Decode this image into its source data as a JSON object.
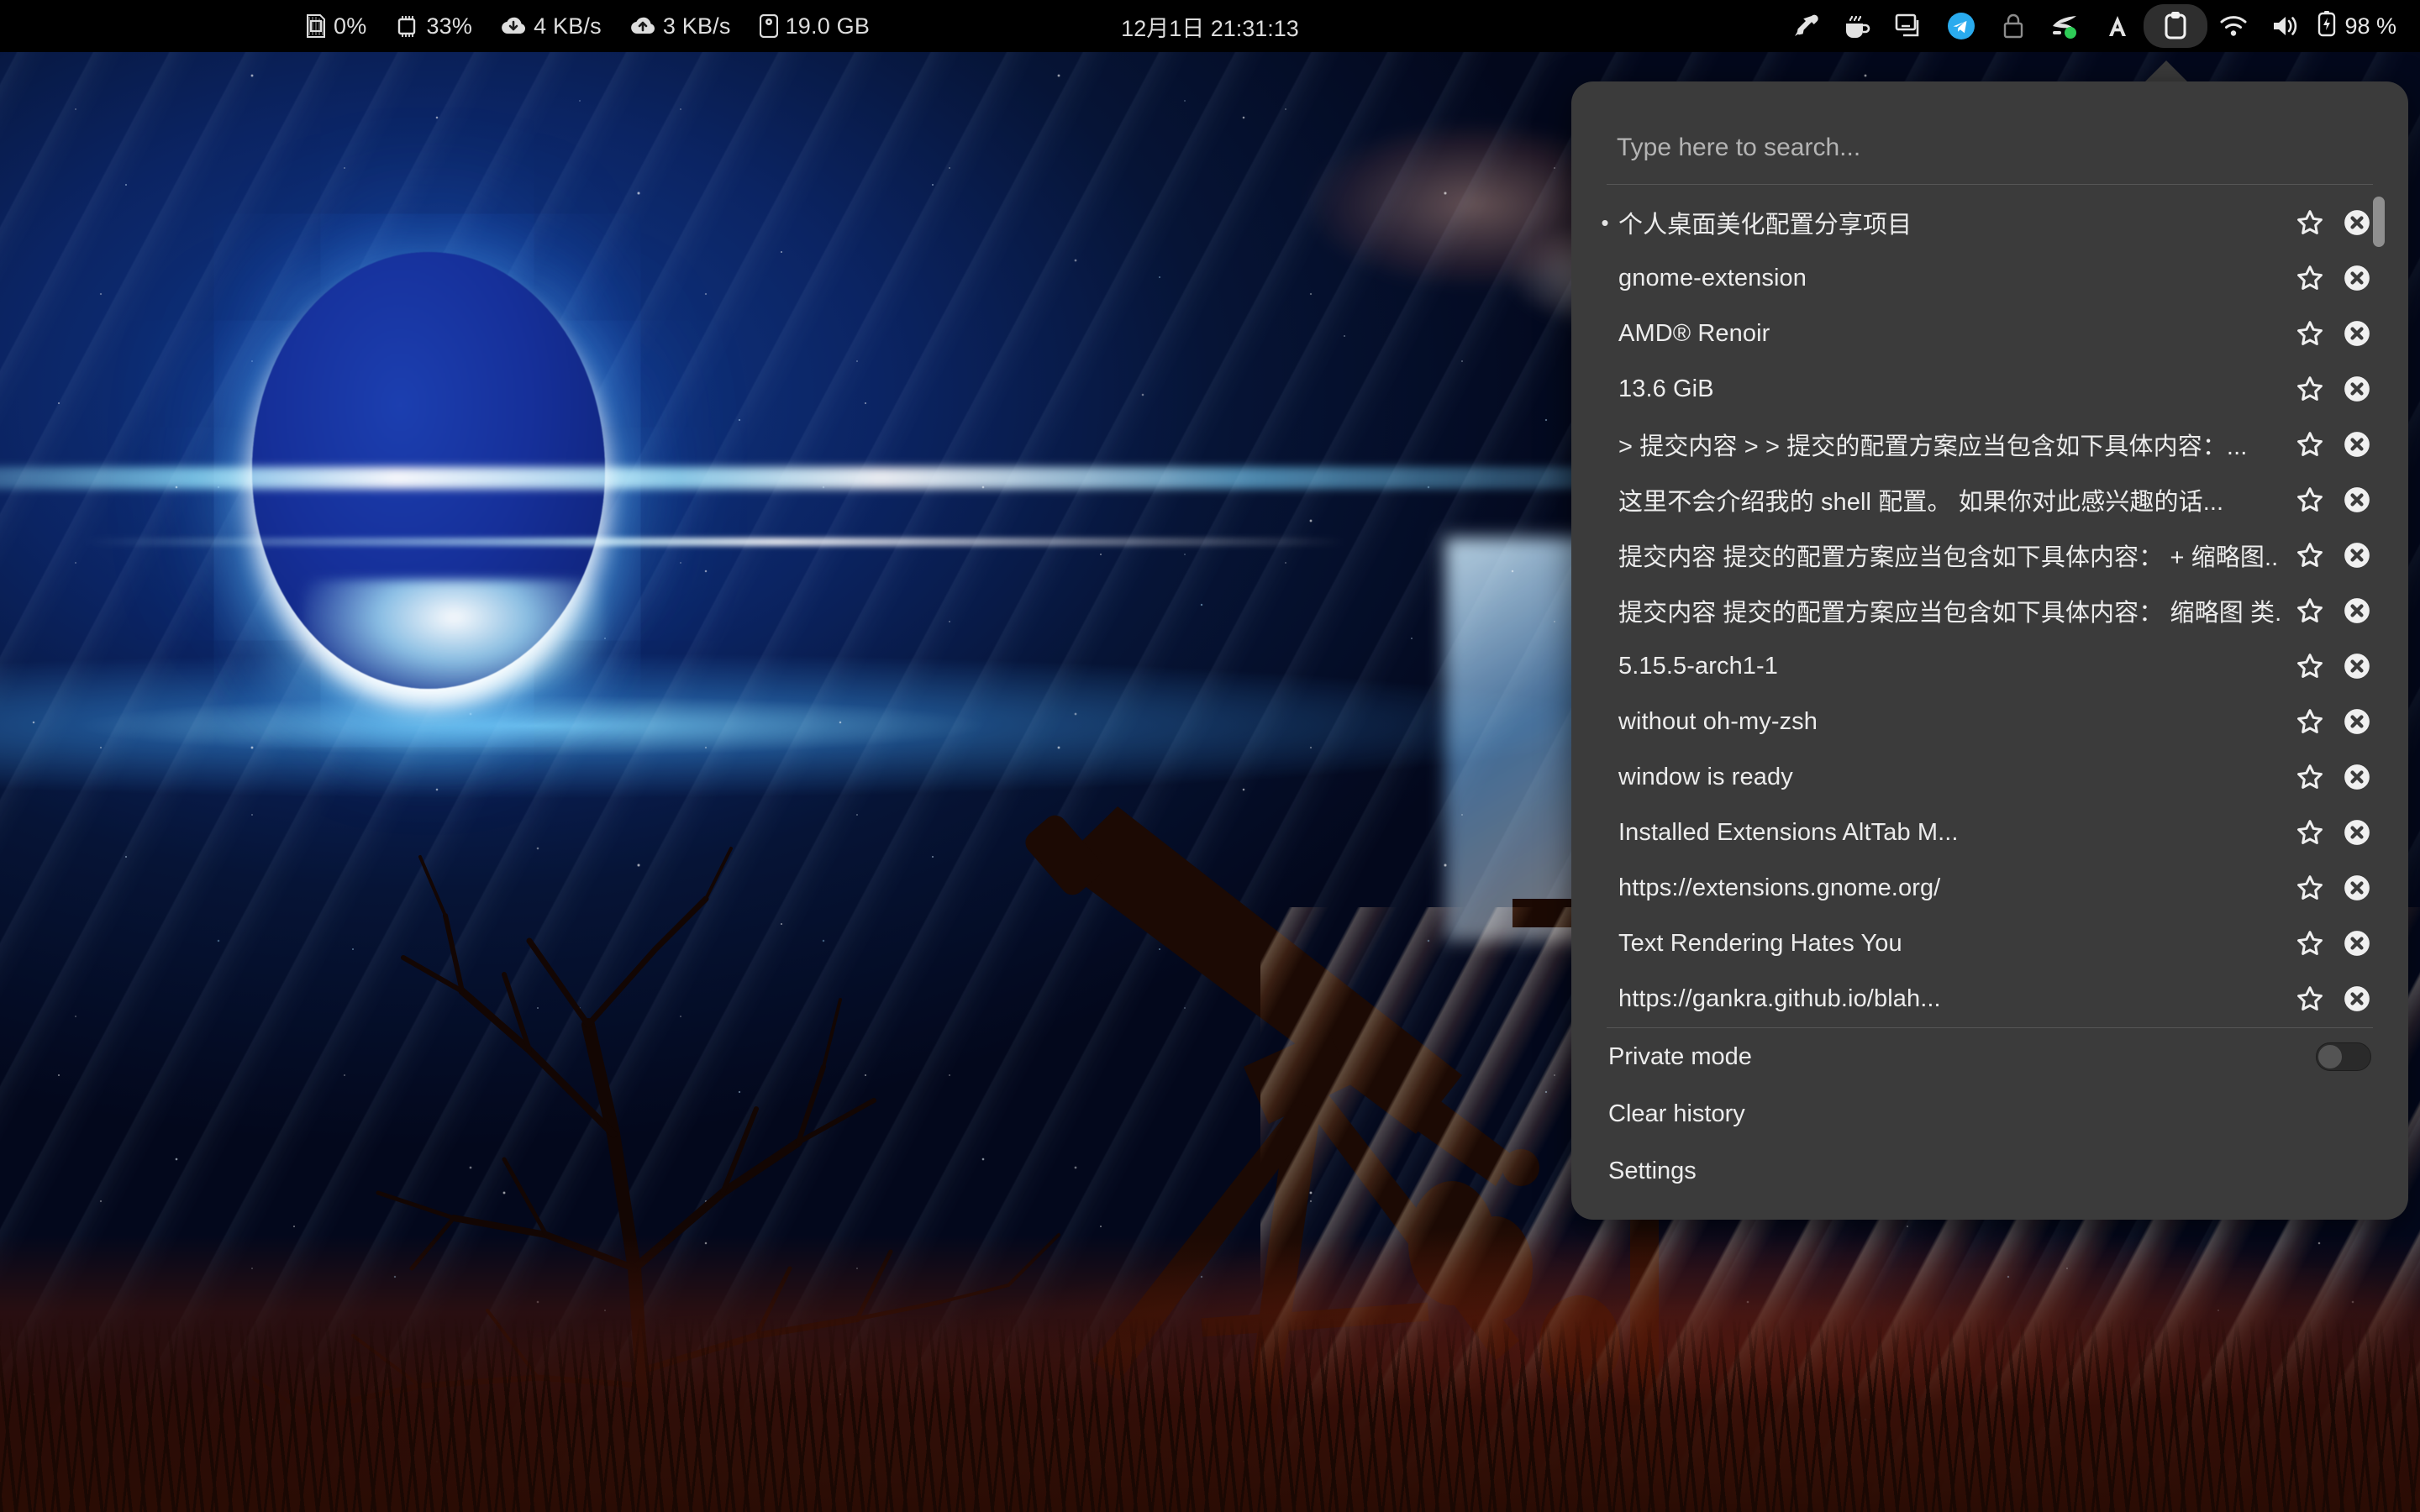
{
  "topbar": {
    "stats": [
      {
        "icon": "memory-icon",
        "label": "0%"
      },
      {
        "icon": "cpu-icon",
        "label": "33%"
      },
      {
        "icon": "download-icon",
        "label": "4 KB/s"
      },
      {
        "icon": "upload-icon",
        "label": "3 KB/s"
      },
      {
        "icon": "disk-icon",
        "label": "19.0 GB"
      }
    ],
    "clock": "12月1日  21:31:13",
    "tray_icons": [
      "color-picker-icon",
      "coffee-icon",
      "screenshot-icon",
      "telegram-icon",
      "lock-icon",
      "night-light-icon",
      "keyboard-layout-icon",
      "clipboard-icon"
    ],
    "status_icons": [
      "wifi-icon",
      "volume-icon",
      "battery-icon"
    ],
    "battery_label": "98 %",
    "active_tray": "clipboard-icon",
    "accent_telegram": "#2aabee",
    "accent_green": "#2ecc57"
  },
  "clipboard": {
    "search": {
      "value": "",
      "placeholder": "Type here to search..."
    },
    "items": [
      {
        "text": "个人桌面美化配置分享项目",
        "current": true
      },
      {
        "text": "gnome-extension",
        "current": false
      },
      {
        "text": "AMD® Renoir",
        "current": false
      },
      {
        "text": "13.6 GiB",
        "current": false
      },
      {
        "text": "> 提交内容 > > 提交的配置方案应当包含如下具体内容：...",
        "current": false
      },
      {
        "text": "这里不会介绍我的 shell 配置。 如果你对此感兴趣的话...",
        "current": false
      },
      {
        "text": "提交内容 提交的配置方案应当包含如下具体内容： + 缩略图...",
        "current": false
      },
      {
        "text": "提交内容 提交的配置方案应当包含如下具体内容： 缩略图 类...",
        "current": false
      },
      {
        "text": "5.15.5-arch1-1",
        "current": false
      },
      {
        "text": "without oh-my-zsh",
        "current": false
      },
      {
        "text": "window is ready",
        "current": false
      },
      {
        "text": "Installed Extensions AltTab M...",
        "current": false
      },
      {
        "text": "https://extensions.gnome.org/",
        "current": false
      },
      {
        "text": "Text Rendering Hates You",
        "current": false
      },
      {
        "text": "https://gankra.github.io/blah...",
        "current": false
      }
    ],
    "row_star_icon": "star-outline-icon",
    "row_delete_icon": "delete-circle-icon",
    "footer": {
      "private_mode_label": "Private mode",
      "private_mode_on": false,
      "clear_history_label": "Clear history",
      "settings_label": "Settings"
    },
    "panel_bg": "#3b3b3b"
  }
}
